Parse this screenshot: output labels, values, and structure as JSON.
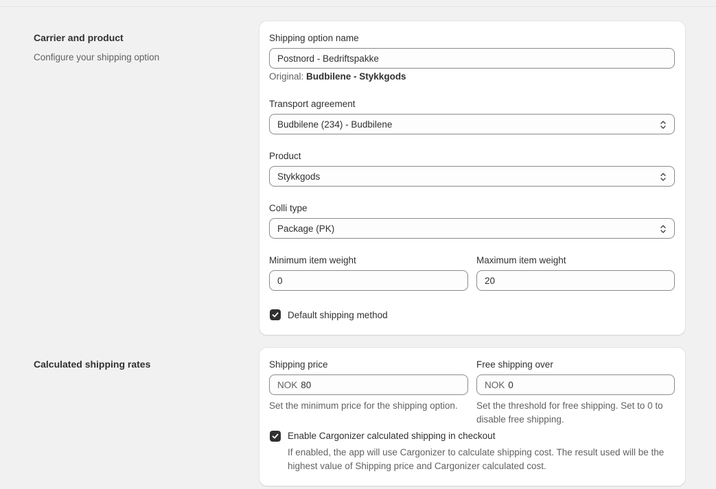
{
  "carrier_section": {
    "title": "Carrier and product",
    "description": "Configure your shipping option"
  },
  "carrier_card": {
    "shipping_option_name": {
      "label": "Shipping option name",
      "value": "Postnord - Bedriftspakke",
      "original_prefix": "Original:",
      "original_value": "Budbilene - Stykkgods"
    },
    "transport_agreement": {
      "label": "Transport agreement",
      "value": "Budbilene (234) - Budbilene"
    },
    "product": {
      "label": "Product",
      "value": "Stykkgods"
    },
    "colli_type": {
      "label": "Colli type",
      "value": "Package (PK)"
    },
    "min_weight": {
      "label": "Minimum item weight",
      "value": "0"
    },
    "max_weight": {
      "label": "Maximum item weight",
      "value": "20"
    },
    "default_method": {
      "label": "Default shipping method",
      "checked": true
    }
  },
  "rates_section": {
    "title": "Calculated shipping rates"
  },
  "rates_card": {
    "shipping_price": {
      "label": "Shipping price",
      "prefix": "NOK",
      "value": "80",
      "help": "Set the minimum price for the shipping option."
    },
    "free_shipping": {
      "label": "Free shipping over",
      "prefix": "NOK",
      "value": "0",
      "help_line1": "Set the threshold for free shipping. Set to 0 to",
      "help_line2": "disable free shipping."
    },
    "cargonizer": {
      "label": "Enable Cargonizer calculated shipping in checkout",
      "checked": true,
      "help_line1": "If enabled, the app will use Cargonizer to calculate shipping cost. The result used will be the",
      "help_line2": "highest value of Shipping price and Cargonizer calculated cost."
    }
  },
  "icons": {
    "select": "chevron-up-down-icon",
    "checkbox": "checkmark-icon"
  },
  "colors": {
    "background": "#f1f1f1",
    "card": "#ffffff",
    "text": "#303030",
    "muted": "#616161",
    "checkbox": "#303030"
  }
}
